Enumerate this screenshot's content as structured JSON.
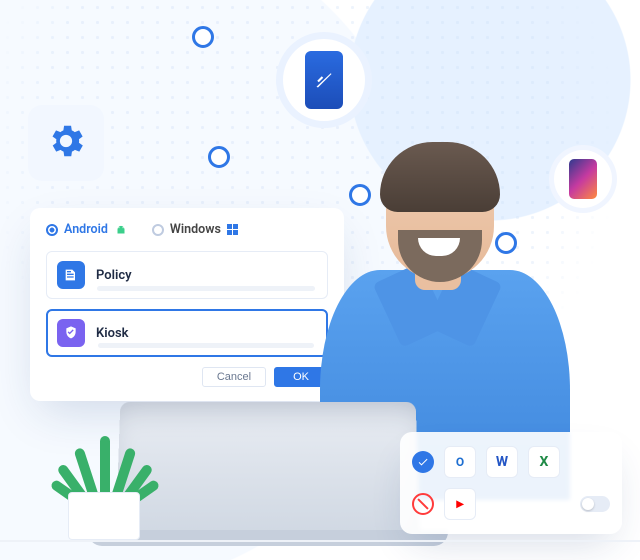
{
  "tabs": {
    "android": "Android",
    "windows": "Windows"
  },
  "rows": {
    "policy": "Policy",
    "kiosk": "Kiosk"
  },
  "buttons": {
    "cancel": "Cancel",
    "ok": "OK"
  },
  "apps": {
    "outlook": "O",
    "word": "W",
    "excel": "X",
    "youtube": "▸"
  }
}
